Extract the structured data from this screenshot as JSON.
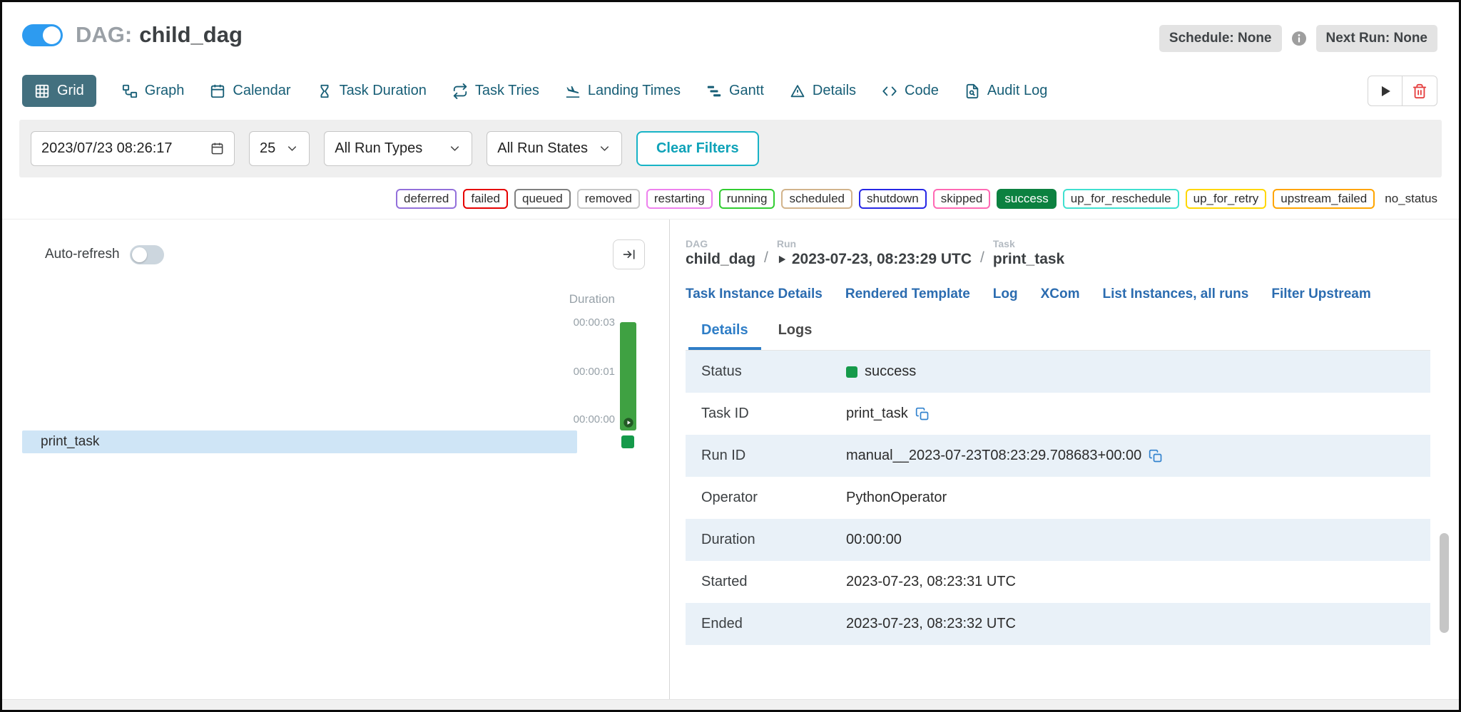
{
  "colors": {
    "toggle_on_blue": "#2d9bf0",
    "active_view_bg": "#43707f",
    "nav_link": "#175e76",
    "accent_teal": "#17b3c6",
    "link_blue": "#2b6cb0",
    "tab_active_blue": "#2f7ec7",
    "success_green": "#159a4a",
    "bar_green": "#3fa142",
    "task_row_highlight": "#cfe5f6",
    "delete_red": "#e53e3e"
  },
  "header": {
    "dag_prefix": "DAG:",
    "dag_name": "child_dag",
    "dag_enabled": true,
    "schedule_badge": "Schedule: None",
    "next_run_badge": "Next Run: None"
  },
  "nav": {
    "tabs": [
      {
        "label": "Grid",
        "active": true
      },
      {
        "label": "Graph",
        "active": false
      },
      {
        "label": "Calendar",
        "active": false
      },
      {
        "label": "Task Duration",
        "active": false
      },
      {
        "label": "Task Tries",
        "active": false
      },
      {
        "label": "Landing Times",
        "active": false
      },
      {
        "label": "Gantt",
        "active": false
      },
      {
        "label": "Details",
        "active": false
      },
      {
        "label": "Code",
        "active": false
      },
      {
        "label": "Audit Log",
        "active": false
      }
    ]
  },
  "filters": {
    "base_date": "2023/07/23 08:26:17",
    "num_runs": "25",
    "run_types": "All Run Types",
    "run_states": "All Run States",
    "clear_label": "Clear Filters"
  },
  "legend": {
    "statuses": [
      {
        "label": "deferred",
        "color": "#9370db",
        "filled": false
      },
      {
        "label": "failed",
        "color": "#e60000",
        "filled": false
      },
      {
        "label": "queued",
        "color": "#808080",
        "filled": false
      },
      {
        "label": "removed",
        "color": "#c8c8c8",
        "filled": false
      },
      {
        "label": "restarting",
        "color": "#ee82ee",
        "filled": false
      },
      {
        "label": "running",
        "color": "#32cd32",
        "filled": false
      },
      {
        "label": "scheduled",
        "color": "#d2b48c",
        "filled": false
      },
      {
        "label": "shutdown",
        "color": "#2727e6",
        "filled": false
      },
      {
        "label": "skipped",
        "color": "#ff69b4",
        "filled": false
      },
      {
        "label": "success",
        "color": "#0c8140",
        "filled": true
      },
      {
        "label": "up_for_reschedule",
        "color": "#40e0d0",
        "filled": false
      },
      {
        "label": "up_for_retry",
        "color": "#ffd700",
        "filled": false
      },
      {
        "label": "upstream_failed",
        "color": "#ffa500",
        "filled": false
      }
    ],
    "no_status_label": "no_status"
  },
  "grid_panel": {
    "auto_refresh_label": "Auto-refresh",
    "auto_refresh_on": false,
    "duration_axis_label": "Duration",
    "ticks": [
      "00:00:03",
      "00:00:01",
      "00:00:00"
    ],
    "task_label": "print_task"
  },
  "details_panel": {
    "breadcrumb": {
      "dag_label": "DAG",
      "dag_value": "child_dag",
      "run_label": "Run",
      "run_value": "2023-07-23, 08:23:29 UTC",
      "task_label": "Task",
      "task_value": "print_task",
      "separator": "/"
    },
    "links": [
      "Task Instance Details",
      "Rendered Template",
      "Log",
      "XCom",
      "List Instances, all runs",
      "Filter Upstream"
    ],
    "tabs": [
      {
        "label": "Details",
        "active": true
      },
      {
        "label": "Logs",
        "active": false
      }
    ],
    "rows": [
      {
        "label": "Status",
        "value": "success"
      },
      {
        "label": "Task ID",
        "value": "print_task"
      },
      {
        "label": "Run ID",
        "value": "manual__2023-07-23T08:23:29.708683+00:00"
      },
      {
        "label": "Operator",
        "value": "PythonOperator"
      },
      {
        "label": "Duration",
        "value": "00:00:00"
      },
      {
        "label": "Started",
        "value": "2023-07-23, 08:23:31 UTC"
      },
      {
        "label": "Ended",
        "value": "2023-07-23, 08:23:32 UTC"
      }
    ]
  }
}
